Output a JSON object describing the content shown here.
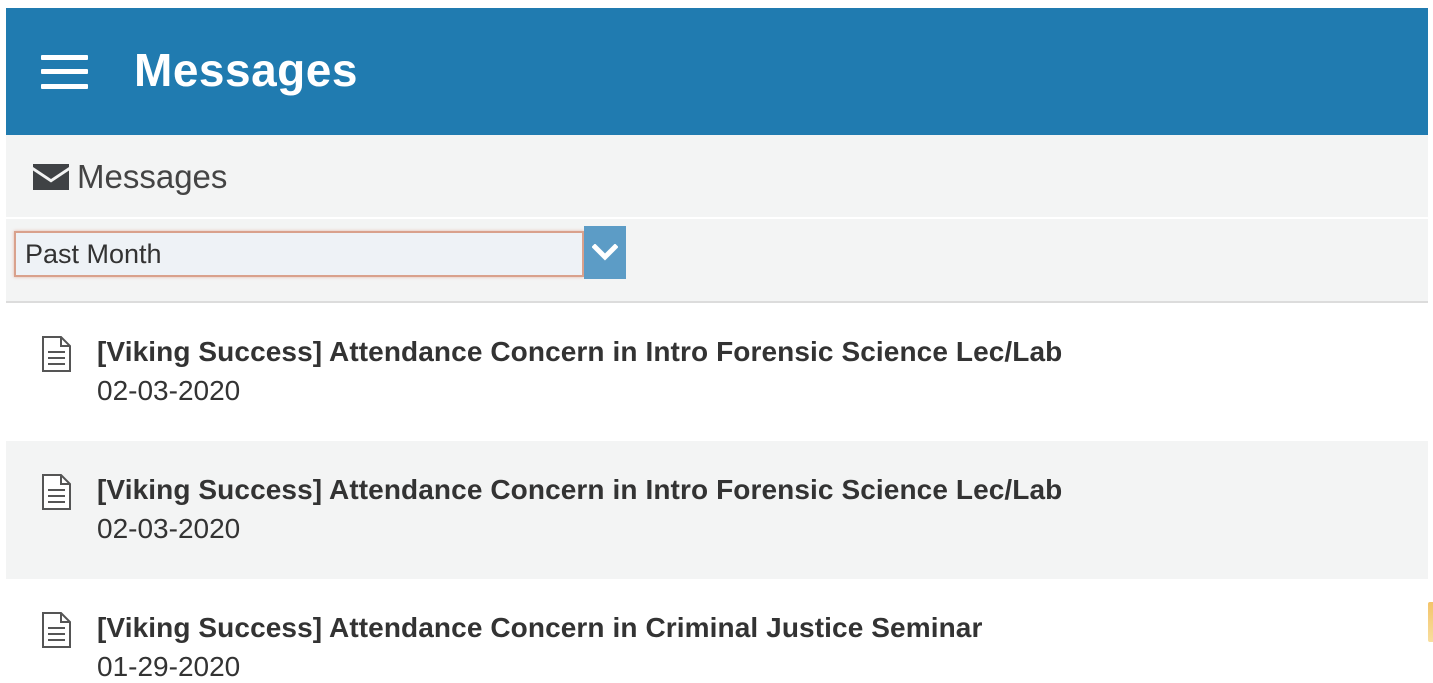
{
  "header": {
    "title": "Messages"
  },
  "section": {
    "title": "Messages",
    "icon": "envelope-icon"
  },
  "filter": {
    "selected": "Past Month"
  },
  "messages": [
    {
      "subject": "[Viking Success] Attendance Concern in Intro Forensic Science Lec/Lab",
      "date": "02-03-2020"
    },
    {
      "subject": "[Viking Success] Attendance Concern in Intro Forensic Science Lec/Lab",
      "date": "02-03-2020"
    },
    {
      "subject": "[Viking Success] Attendance Concern in Criminal Justice Seminar",
      "date": "01-29-2020"
    }
  ],
  "colors": {
    "header_bg": "#207bb0",
    "panel_bg": "#f3f4f4",
    "dropdown_button": "#5c9cc6",
    "select_border": "#d9a18c",
    "text": "#333333"
  }
}
